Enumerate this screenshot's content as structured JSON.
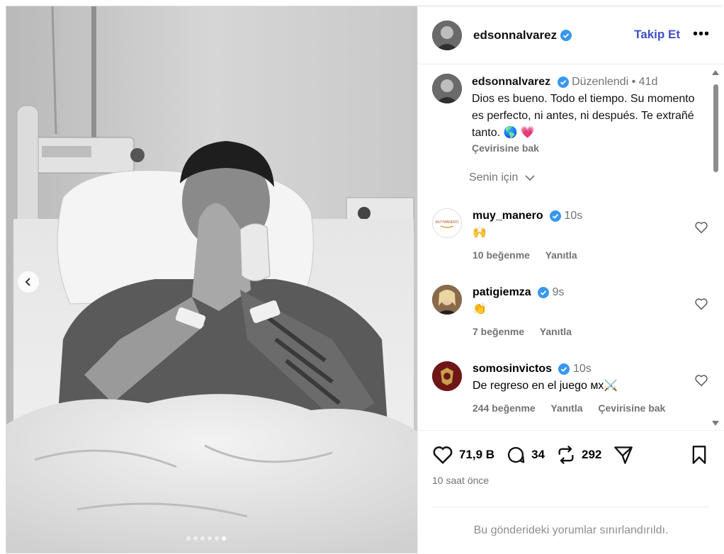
{
  "post": {
    "author": "edsonnalvarez",
    "follow_label": "Takip Et",
    "more_label": "•••",
    "carousel": {
      "slide_count": 6,
      "active_index": 5
    }
  },
  "caption": {
    "author": "edsonnalvarez",
    "edited_label": "Düzenlendi",
    "separator": "•",
    "age": "41d",
    "text": "Dios es bueno. Todo el tiempo. Su momento es perfecto, ni antes, ni después. Te extrañé tanto. 🌎 💗",
    "translate_label": "Çevirisine bak"
  },
  "for_you_label": "Senin için",
  "comments": [
    {
      "author": "muy_manero",
      "age": "10s",
      "text": "🙌",
      "likes": "10 beğenme",
      "reply": "Yanıtla",
      "translate": ""
    },
    {
      "author": "patigiemza",
      "age": "9s",
      "text": "👏",
      "likes": "7 beğenme",
      "reply": "Yanıtla",
      "translate": ""
    },
    {
      "author": "somosinvictos",
      "age": "10s",
      "text": "De regreso en el juego ᴍx⚔️",
      "likes": "244 beğenme",
      "reply": "Yanıtla",
      "translate": "Çevirisine bak"
    }
  ],
  "actions": {
    "likes": "71,9 B",
    "comments": "34",
    "reposts": "292"
  },
  "time_ago": "10 saat önce",
  "restricted_notice": "Bu gönderideki yorumlar sınırlandırıldı.",
  "colors": {
    "follow": "#4150c9",
    "verified": "#3897f0",
    "muted": "#737373"
  }
}
